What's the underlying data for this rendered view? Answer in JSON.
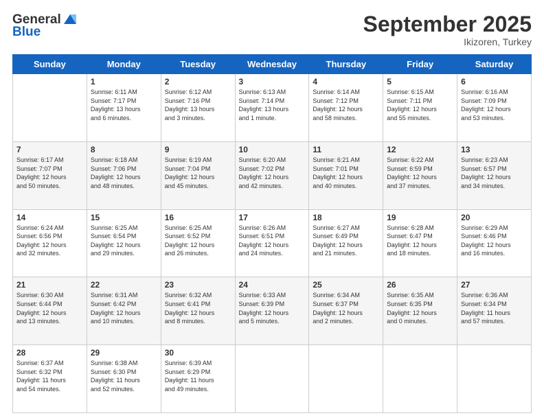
{
  "header": {
    "logo_line1": "General",
    "logo_line2": "Blue",
    "month": "September 2025",
    "location": "Ikizoren, Turkey"
  },
  "days_of_week": [
    "Sunday",
    "Monday",
    "Tuesday",
    "Wednesday",
    "Thursday",
    "Friday",
    "Saturday"
  ],
  "weeks": [
    [
      {
        "day": "",
        "info": ""
      },
      {
        "day": "1",
        "info": "Sunrise: 6:11 AM\nSunset: 7:17 PM\nDaylight: 13 hours\nand 6 minutes."
      },
      {
        "day": "2",
        "info": "Sunrise: 6:12 AM\nSunset: 7:16 PM\nDaylight: 13 hours\nand 3 minutes."
      },
      {
        "day": "3",
        "info": "Sunrise: 6:13 AM\nSunset: 7:14 PM\nDaylight: 13 hours\nand 1 minute."
      },
      {
        "day": "4",
        "info": "Sunrise: 6:14 AM\nSunset: 7:12 PM\nDaylight: 12 hours\nand 58 minutes."
      },
      {
        "day": "5",
        "info": "Sunrise: 6:15 AM\nSunset: 7:11 PM\nDaylight: 12 hours\nand 55 minutes."
      },
      {
        "day": "6",
        "info": "Sunrise: 6:16 AM\nSunset: 7:09 PM\nDaylight: 12 hours\nand 53 minutes."
      }
    ],
    [
      {
        "day": "7",
        "info": "Sunrise: 6:17 AM\nSunset: 7:07 PM\nDaylight: 12 hours\nand 50 minutes."
      },
      {
        "day": "8",
        "info": "Sunrise: 6:18 AM\nSunset: 7:06 PM\nDaylight: 12 hours\nand 48 minutes."
      },
      {
        "day": "9",
        "info": "Sunrise: 6:19 AM\nSunset: 7:04 PM\nDaylight: 12 hours\nand 45 minutes."
      },
      {
        "day": "10",
        "info": "Sunrise: 6:20 AM\nSunset: 7:02 PM\nDaylight: 12 hours\nand 42 minutes."
      },
      {
        "day": "11",
        "info": "Sunrise: 6:21 AM\nSunset: 7:01 PM\nDaylight: 12 hours\nand 40 minutes."
      },
      {
        "day": "12",
        "info": "Sunrise: 6:22 AM\nSunset: 6:59 PM\nDaylight: 12 hours\nand 37 minutes."
      },
      {
        "day": "13",
        "info": "Sunrise: 6:23 AM\nSunset: 6:57 PM\nDaylight: 12 hours\nand 34 minutes."
      }
    ],
    [
      {
        "day": "14",
        "info": "Sunrise: 6:24 AM\nSunset: 6:56 PM\nDaylight: 12 hours\nand 32 minutes."
      },
      {
        "day": "15",
        "info": "Sunrise: 6:25 AM\nSunset: 6:54 PM\nDaylight: 12 hours\nand 29 minutes."
      },
      {
        "day": "16",
        "info": "Sunrise: 6:25 AM\nSunset: 6:52 PM\nDaylight: 12 hours\nand 26 minutes."
      },
      {
        "day": "17",
        "info": "Sunrise: 6:26 AM\nSunset: 6:51 PM\nDaylight: 12 hours\nand 24 minutes."
      },
      {
        "day": "18",
        "info": "Sunrise: 6:27 AM\nSunset: 6:49 PM\nDaylight: 12 hours\nand 21 minutes."
      },
      {
        "day": "19",
        "info": "Sunrise: 6:28 AM\nSunset: 6:47 PM\nDaylight: 12 hours\nand 18 minutes."
      },
      {
        "day": "20",
        "info": "Sunrise: 6:29 AM\nSunset: 6:46 PM\nDaylight: 12 hours\nand 16 minutes."
      }
    ],
    [
      {
        "day": "21",
        "info": "Sunrise: 6:30 AM\nSunset: 6:44 PM\nDaylight: 12 hours\nand 13 minutes."
      },
      {
        "day": "22",
        "info": "Sunrise: 6:31 AM\nSunset: 6:42 PM\nDaylight: 12 hours\nand 10 minutes."
      },
      {
        "day": "23",
        "info": "Sunrise: 6:32 AM\nSunset: 6:41 PM\nDaylight: 12 hours\nand 8 minutes."
      },
      {
        "day": "24",
        "info": "Sunrise: 6:33 AM\nSunset: 6:39 PM\nDaylight: 12 hours\nand 5 minutes."
      },
      {
        "day": "25",
        "info": "Sunrise: 6:34 AM\nSunset: 6:37 PM\nDaylight: 12 hours\nand 2 minutes."
      },
      {
        "day": "26",
        "info": "Sunrise: 6:35 AM\nSunset: 6:35 PM\nDaylight: 12 hours\nand 0 minutes."
      },
      {
        "day": "27",
        "info": "Sunrise: 6:36 AM\nSunset: 6:34 PM\nDaylight: 11 hours\nand 57 minutes."
      }
    ],
    [
      {
        "day": "28",
        "info": "Sunrise: 6:37 AM\nSunset: 6:32 PM\nDaylight: 11 hours\nand 54 minutes."
      },
      {
        "day": "29",
        "info": "Sunrise: 6:38 AM\nSunset: 6:30 PM\nDaylight: 11 hours\nand 52 minutes."
      },
      {
        "day": "30",
        "info": "Sunrise: 6:39 AM\nSunset: 6:29 PM\nDaylight: 11 hours\nand 49 minutes."
      },
      {
        "day": "",
        "info": ""
      },
      {
        "day": "",
        "info": ""
      },
      {
        "day": "",
        "info": ""
      },
      {
        "day": "",
        "info": ""
      }
    ]
  ]
}
